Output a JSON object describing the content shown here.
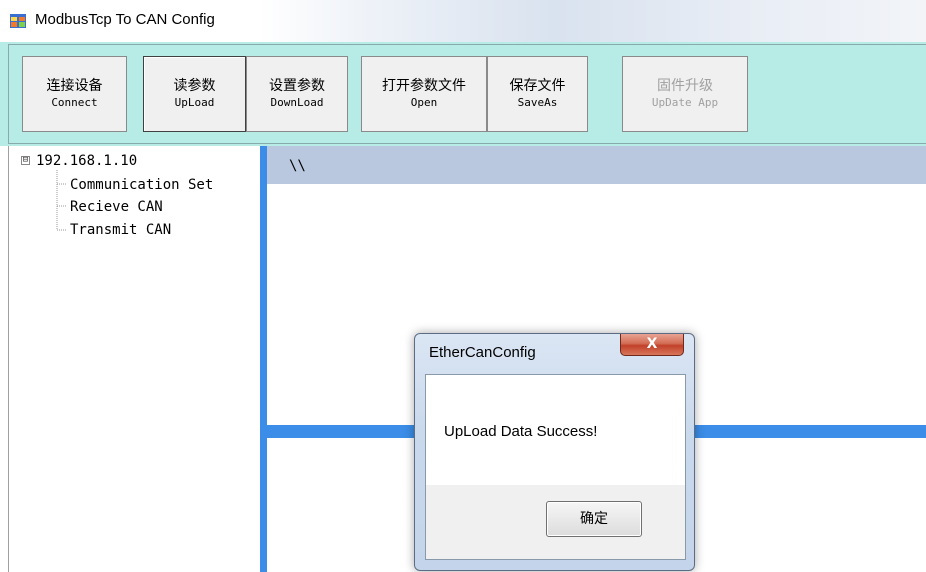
{
  "window": {
    "title": "ModbusTcp To CAN Config",
    "icon": "app-window-icon"
  },
  "toolbar": {
    "buttons": [
      {
        "cn": "连接设备",
        "en": "Connect",
        "state": "normal"
      },
      {
        "cn": "读参数",
        "en": "UpLoad",
        "state": "pressed"
      },
      {
        "cn": "设置参数",
        "en": "DownLoad",
        "state": "normal"
      },
      {
        "cn": "打开参数文件",
        "en": "Open",
        "state": "normal"
      },
      {
        "cn": "保存文件",
        "en": "SaveAs",
        "state": "normal"
      },
      {
        "cn": "固件升级",
        "en": "UpDate App",
        "state": "disabled"
      }
    ],
    "background": "#b7ece6"
  },
  "tree": {
    "root": "192.168.1.10",
    "expander": "⊟",
    "children": [
      "Communication Set",
      "Recieve CAN",
      "Transmit CAN"
    ]
  },
  "path_bar": {
    "text": "\\\\"
  },
  "dialog": {
    "title": "EtherCanConfig",
    "close_label": "X",
    "message": "UpLoad Data Success!",
    "ok_label": "确定"
  },
  "colors": {
    "splitter_blue": "#3b8de8",
    "path_bar": "#b9c8de"
  }
}
